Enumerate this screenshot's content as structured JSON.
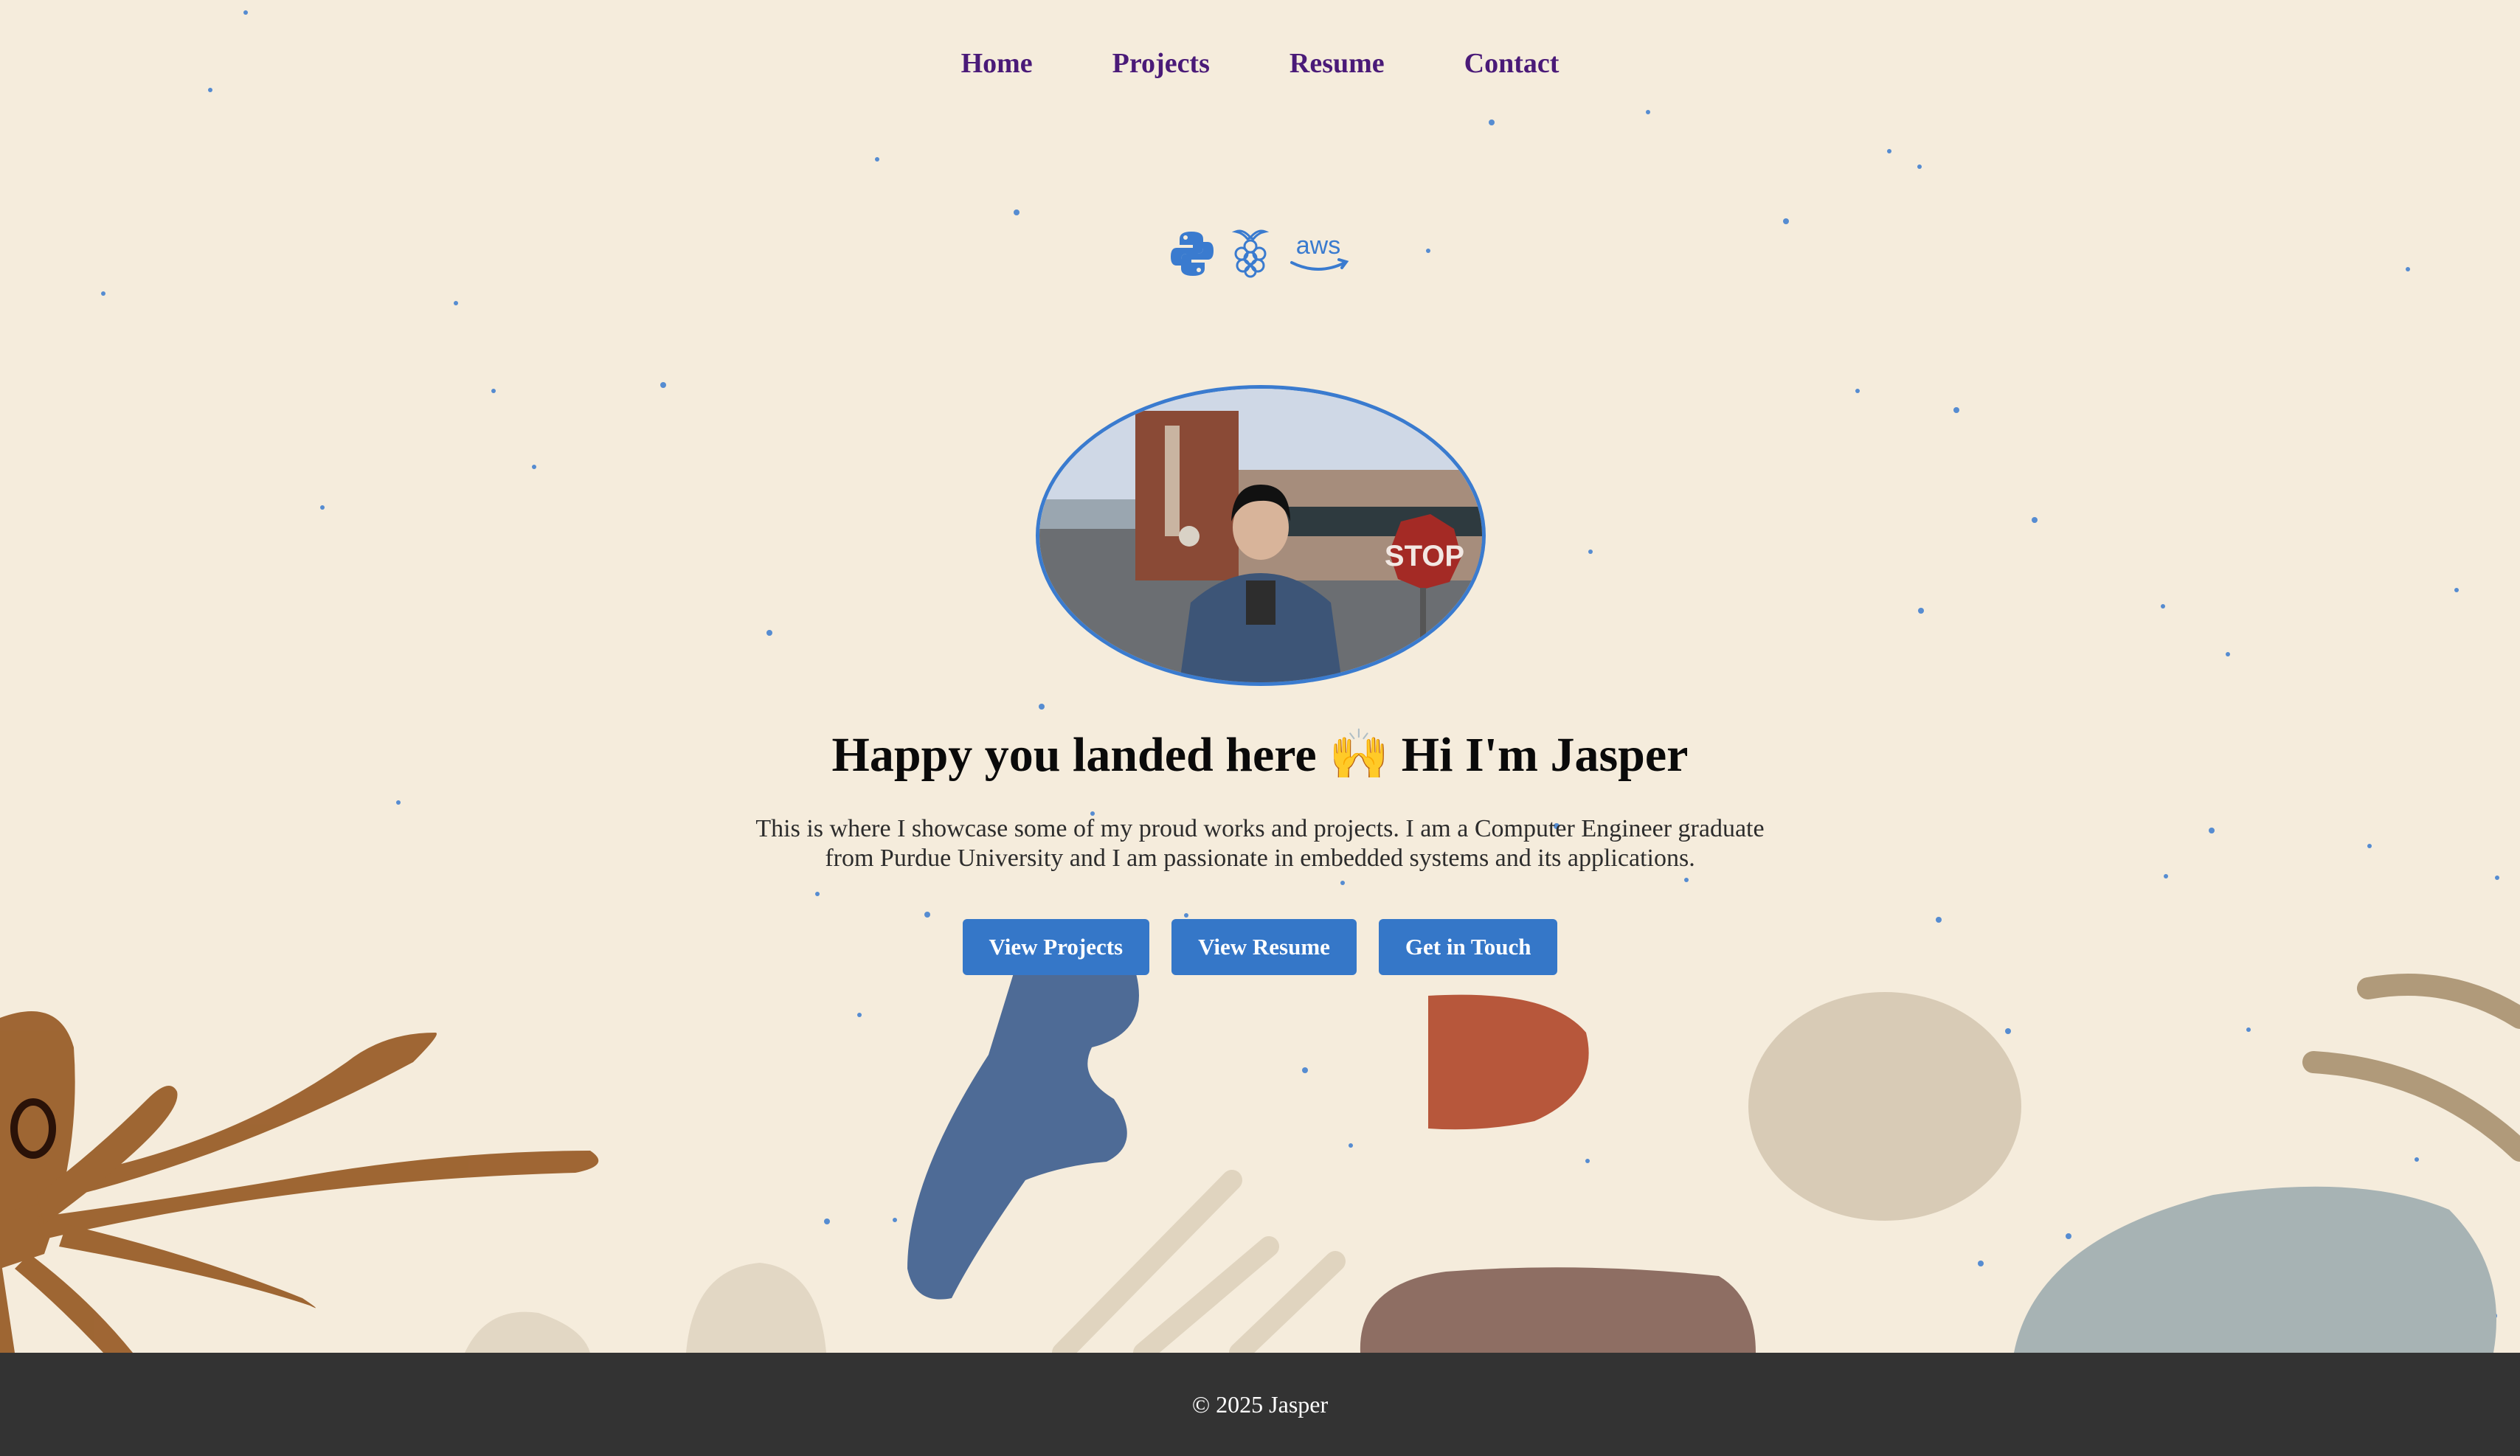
{
  "nav": {
    "items": [
      {
        "label": "Home"
      },
      {
        "label": "Projects"
      },
      {
        "label": "Resume"
      },
      {
        "label": "Contact"
      }
    ]
  },
  "tech_icons": [
    "python-icon",
    "raspberry-pi-icon",
    "aws-icon"
  ],
  "aws_label": "aws",
  "profile_photo": {
    "sign_text": "STOP"
  },
  "hero": {
    "headline": "Happy you landed here 🙌 Hi I'm Jasper",
    "intro": "This is where I showcase some of my proud works and projects. I am a Computer Engineer graduate from Purdue University and I am passionate in embedded systems and its applications."
  },
  "buttons": {
    "projects": "View Projects",
    "resume": "View Resume",
    "contact": "Get in Touch"
  },
  "footer": {
    "copyright": "© 2025 Jasper"
  },
  "colors": {
    "background": "#f5ecdc",
    "nav_link": "#4a1a78",
    "button": "#3577c8",
    "footer": "#333333"
  }
}
